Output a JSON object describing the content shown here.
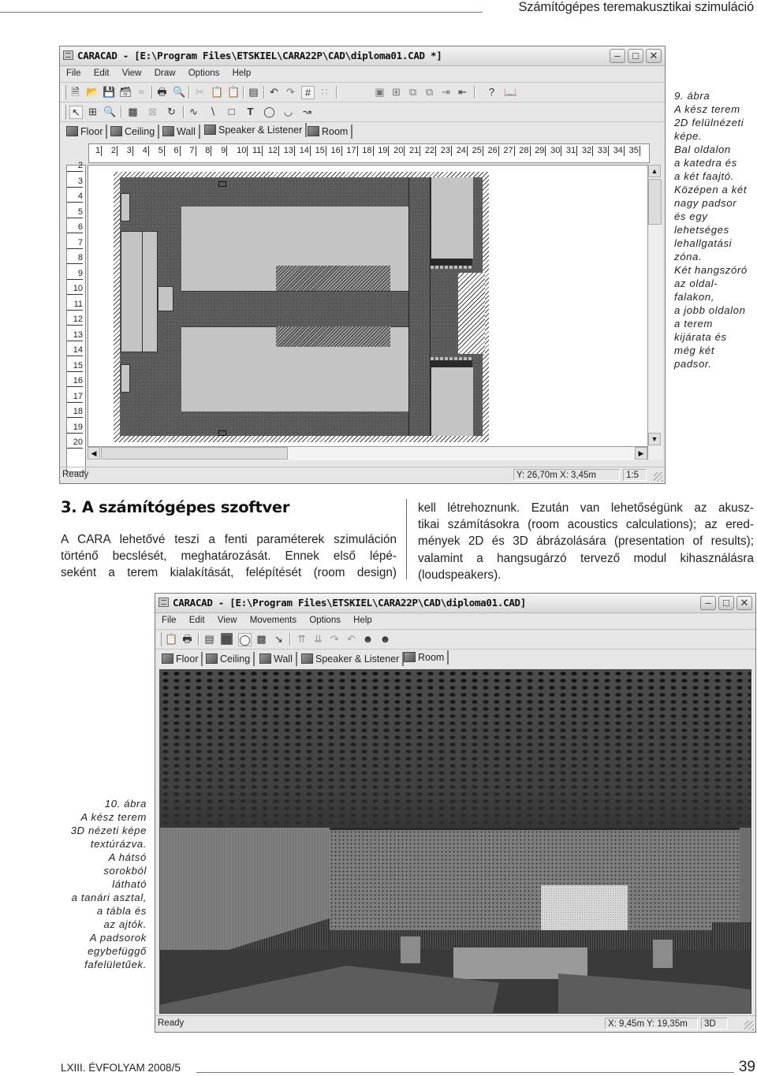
{
  "running_header": "Számítógépes teremakusztikai szimuláció",
  "figure9": {
    "window": {
      "title": "CARACAD - [E:\\Program Files\\ETSKIEL\\CARA22P\\CAD\\diploma01.CAD *]",
      "controls": {
        "minimize": "minimize-icon",
        "maximize": "maximize-icon",
        "close": "close-icon"
      },
      "menu": [
        "File",
        "Edit",
        "View",
        "Draw",
        "Options",
        "Help"
      ],
      "toolbar1": [
        "new-icon",
        "open-icon",
        "save-icon",
        "save-as-icon",
        "ruler-icon",
        "print-icon",
        "print-preview-icon",
        "cut-icon",
        "copy-icon",
        "paste-icon",
        "properties-icon",
        "undo-icon",
        "redo-icon",
        "grid-icon",
        "snap-grid-icon",
        "room-icon",
        "split-icon",
        "layer-front-icon",
        "layer-back-icon",
        "import-icon",
        "export-icon",
        "help-icon",
        "manual-icon"
      ],
      "toolbar2": [
        "select-icon",
        "zoom-box-icon",
        "zoom-in-icon",
        "object-icon",
        "delete-icon",
        "rotate-icon",
        "polyline-icon",
        "line-icon",
        "rectangle-icon",
        "text-icon",
        "circle-icon",
        "arc-icon",
        "curve-icon"
      ],
      "tabs": [
        {
          "label": "Floor",
          "icon": "floor-icon"
        },
        {
          "label": "Ceiling",
          "icon": "ceiling-icon"
        },
        {
          "label": "Wall",
          "icon": "wall-icon"
        },
        {
          "label": "Speaker & Listener",
          "icon": "speaker-icon",
          "active": true
        },
        {
          "label": "Room",
          "icon": "room-icon"
        }
      ],
      "ruler_h": [
        "1",
        "2",
        "3",
        "4",
        "5",
        "6",
        "7",
        "8",
        "9",
        "10",
        "11",
        "12",
        "13",
        "14",
        "15",
        "16",
        "17",
        "18",
        "19",
        "20",
        "21",
        "22",
        "23",
        "24",
        "25",
        "26",
        "27",
        "28",
        "29",
        "30",
        "31",
        "32",
        "33",
        "34",
        "35"
      ],
      "ruler_v": [
        "2",
        "3",
        "4",
        "5",
        "6",
        "7",
        "8",
        "9",
        "10",
        "11",
        "12",
        "13",
        "14",
        "15",
        "16",
        "17",
        "18",
        "19",
        "20"
      ],
      "status": {
        "text": "Ready",
        "coords": "Y: 26,70m X:  3,45m",
        "scale": "1:5"
      }
    },
    "caption": [
      "9. ábra",
      "A kész terem",
      "2D felülnézeti",
      "képe.",
      "Bal oldalon",
      "a katedra és",
      "a két faajtó.",
      "Középen a két",
      "nagy padsor",
      "és egy",
      "lehetséges",
      "lehallgatási",
      "zóna.",
      "Két hangszóró",
      "az oldal-",
      "falakon,",
      "a jobb oldalon",
      "a terem",
      "kijárata és",
      "még két",
      "padsor."
    ]
  },
  "section": {
    "title": "3. A számítógépes szoftver",
    "left_lines": [
      "A CARA lehetővé teszi a fenti paraméterek szimuláción",
      "történő becslését, meghatározását. Ennek első lépé-",
      "seként a terem kialakítását, felépítését (room design)"
    ],
    "right_lines": [
      "kell létrehoznunk. Ezután van lehetőségünk az akusz-",
      "tikai számításokra (room acoustics calculations); az ered-",
      "mények 2D és 3D ábrázolására (presentation of results);",
      "valamint a hangsugárzó tervező modul kihasználásra",
      "(loudspeakers)."
    ]
  },
  "figure10": {
    "window": {
      "title": "CARACAD - [E:\\Program Files\\ETSKIEL\\CARA22P\\CAD\\diploma01.CAD]",
      "controls": {
        "minimize": "minimize-icon",
        "maximize": "maximize-icon",
        "close": "close-icon"
      },
      "menu": [
        "File",
        "Edit",
        "View",
        "Movements",
        "Options",
        "Help"
      ],
      "toolbar": [
        "copy-icon",
        "print-icon",
        "properties-icon",
        "texture-icon",
        "light-icon",
        "speaker-icon",
        "path-icon",
        "move-up-icon",
        "move-down-icon",
        "rotate-right-icon",
        "rotate-left-icon",
        "listener-up-icon",
        "listener-down-icon"
      ],
      "tabs": [
        {
          "label": "Floor",
          "icon": "floor-icon"
        },
        {
          "label": "Ceiling",
          "icon": "ceiling-icon"
        },
        {
          "label": "Wall",
          "icon": "wall-icon"
        },
        {
          "label": "Speaker & Listener",
          "icon": "speaker-icon"
        },
        {
          "label": "Room",
          "icon": "room-icon",
          "active": true
        }
      ],
      "status": {
        "text": "Ready",
        "coords": "X:  9,45m Y: 19,35m",
        "mode": "3D"
      }
    },
    "caption": [
      "10. ábra",
      "A kész terem",
      "3D nézeti képe",
      "textúrázva.",
      "A hátsó",
      "sorokból",
      "látható",
      "a tanári asztal,",
      "a tábla és",
      "az ajtók.",
      "A padsorok",
      "egybefüggő",
      "fafelületűek."
    ]
  },
  "footer": {
    "journal": "LXIII. ÉVFOLYAM 2008/5",
    "page": "39"
  }
}
